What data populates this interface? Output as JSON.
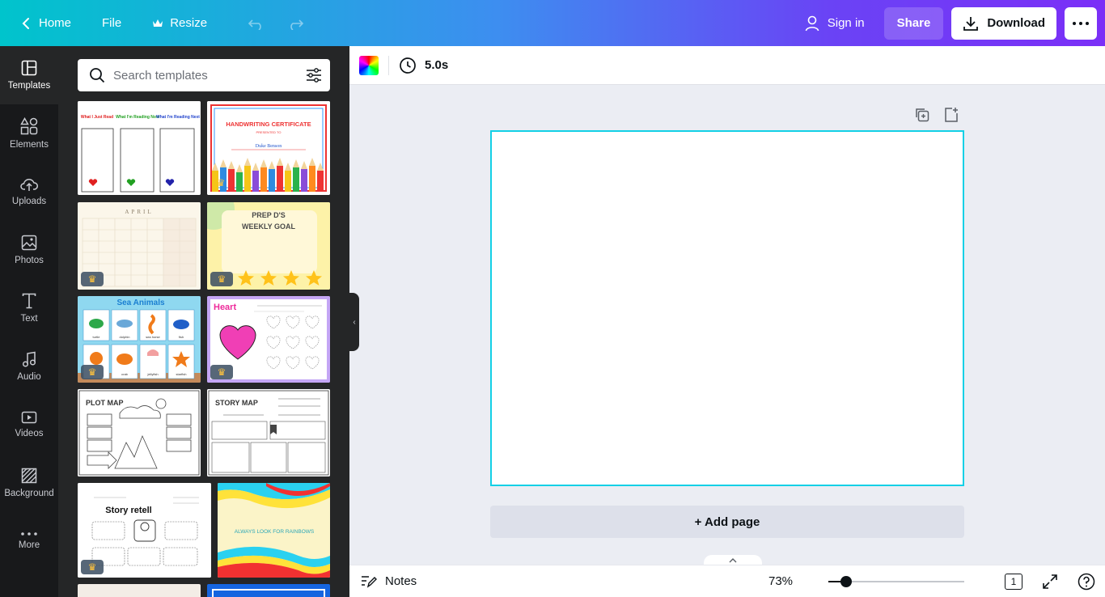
{
  "topbar": {
    "home_label": "Home",
    "file_label": "File",
    "resize_label": "Resize",
    "signin_label": "Sign in",
    "share_label": "Share",
    "download_label": "Download"
  },
  "rail": {
    "items": [
      {
        "label": "Templates",
        "icon": "templates-icon"
      },
      {
        "label": "Elements",
        "icon": "elements-icon"
      },
      {
        "label": "Uploads",
        "icon": "uploads-icon"
      },
      {
        "label": "Photos",
        "icon": "photos-icon"
      },
      {
        "label": "Text",
        "icon": "text-icon"
      },
      {
        "label": "Audio",
        "icon": "audio-icon"
      },
      {
        "label": "Videos",
        "icon": "videos-icon"
      },
      {
        "label": "Background",
        "icon": "background-icon"
      },
      {
        "label": "More",
        "icon": "more-dots-icon"
      }
    ]
  },
  "panel": {
    "search_placeholder": "Search templates",
    "templates": [
      {
        "title_lines": [
          "What I Just Read",
          "What I'm Reading Now",
          "What I'm Reading Next"
        ],
        "premium": false
      },
      {
        "title": "HANDWRITING CERTIFICATE",
        "subtitle": "PRESENTED TO",
        "name": "Duke Benson",
        "premium": true
      },
      {
        "title": "APRIL",
        "premium": true
      },
      {
        "title": "PREP D'S WEEKLY GOAL",
        "premium": true
      },
      {
        "title": "Sea Animals",
        "labels": [
          "turtle",
          "dolphin",
          "sea horse",
          "fish",
          "octopus",
          "crab",
          "jellyfish",
          "starfish"
        ],
        "premium": true
      },
      {
        "title": "Heart",
        "premium": true
      },
      {
        "title": "PLOT MAP",
        "premium": false
      },
      {
        "title": "STORY MAP",
        "premium": false
      },
      {
        "title": "Story retell",
        "premium": true
      },
      {
        "title": "ALWAYS LOOK FOR RAINBOWS",
        "premium": false
      }
    ]
  },
  "editor": {
    "duration": "5.0s",
    "add_page_label": "+ Add page"
  },
  "footer": {
    "notes_label": "Notes",
    "zoom": "73%",
    "zoom_slider_fraction": 0.13,
    "page_count": "1"
  },
  "colors": {
    "accent_border": "#13d0e6",
    "rail_bg": "#18191b",
    "panel_bg": "#252627"
  }
}
